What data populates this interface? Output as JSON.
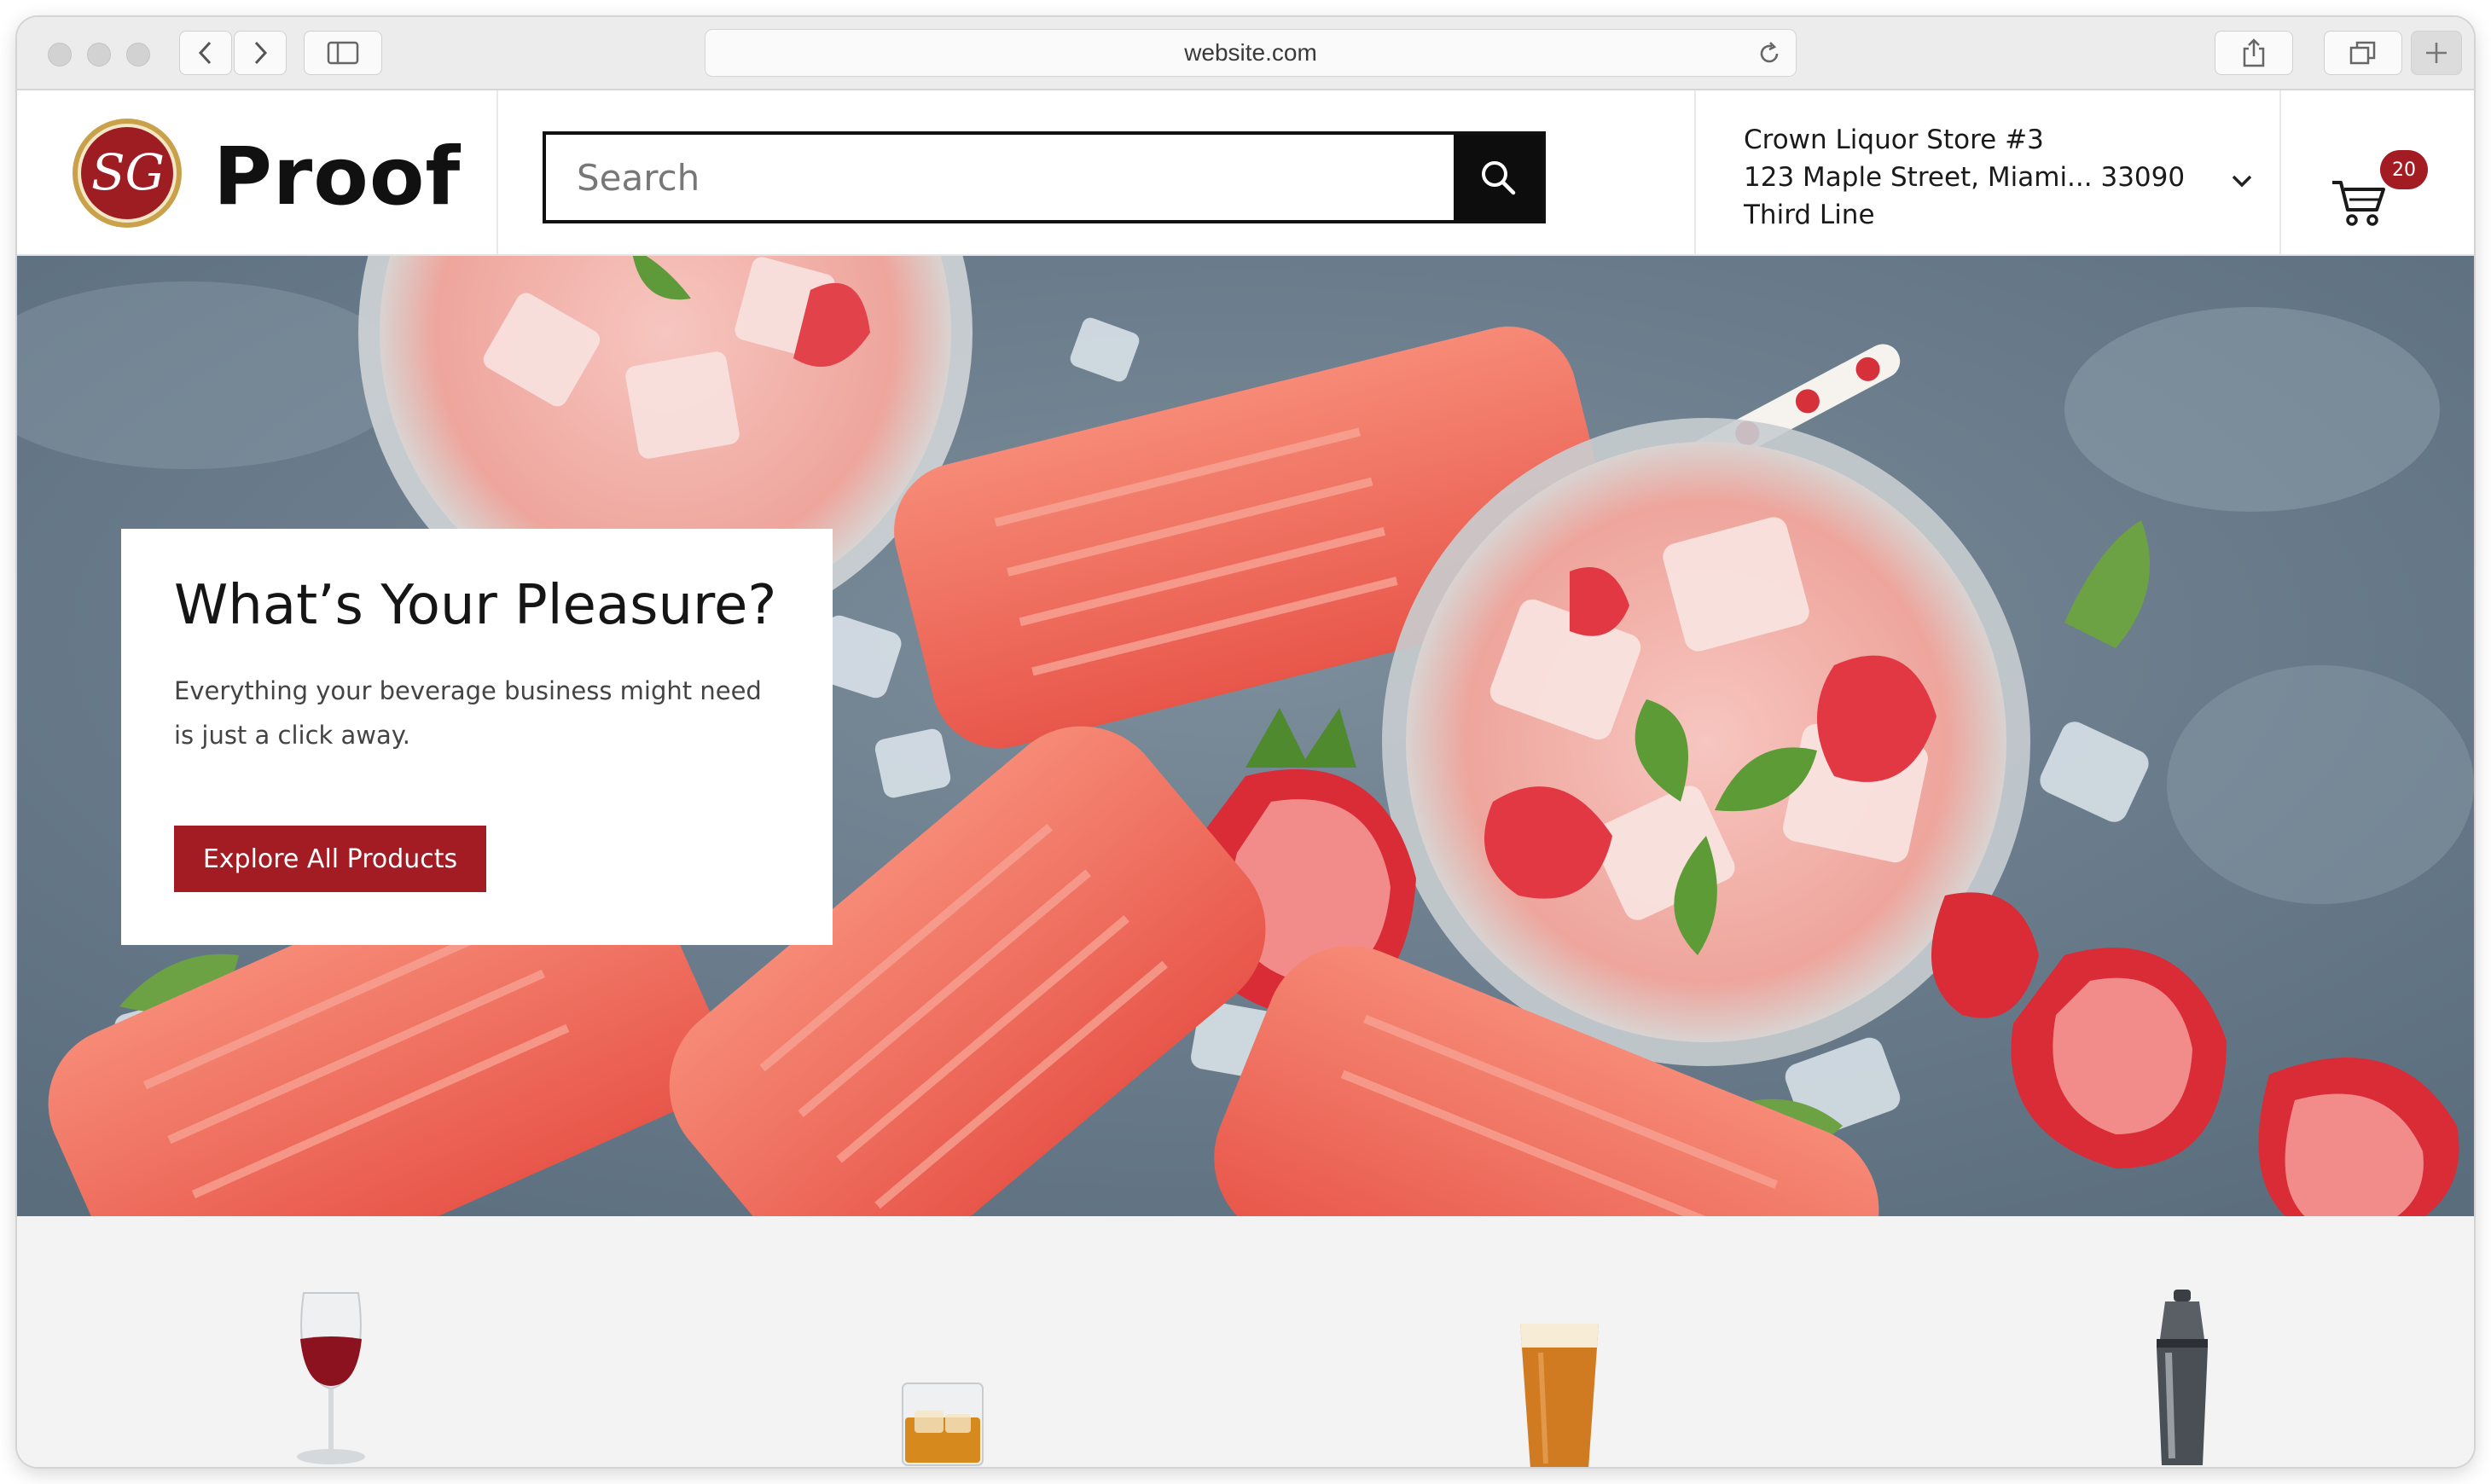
{
  "browser": {
    "url": "website.com"
  },
  "brand": {
    "monogram": "SG",
    "name": "Proof"
  },
  "search": {
    "placeholder": "Search",
    "value": ""
  },
  "store": {
    "name": "Crown Liquor Store #3",
    "address": "123 Maple Street, Miami... 33090",
    "third_line": "Third Line"
  },
  "cart": {
    "count": "20"
  },
  "hero": {
    "title": "What’s Your Pleasure?",
    "subtitle": "Everything your beverage business might need is just a click away.",
    "cta_label": "Explore All Products"
  },
  "categories": [
    {
      "icon": "wine-glass-icon"
    },
    {
      "icon": "whiskey-glass-icon"
    },
    {
      "icon": "beer-glass-icon"
    },
    {
      "icon": "cocktail-shaker-icon"
    }
  ],
  "colors": {
    "brand_red": "#a31c24",
    "brand_gold": "#c9a14a",
    "black": "#0d0d0d",
    "hero_bg": "#6b7d8c"
  }
}
